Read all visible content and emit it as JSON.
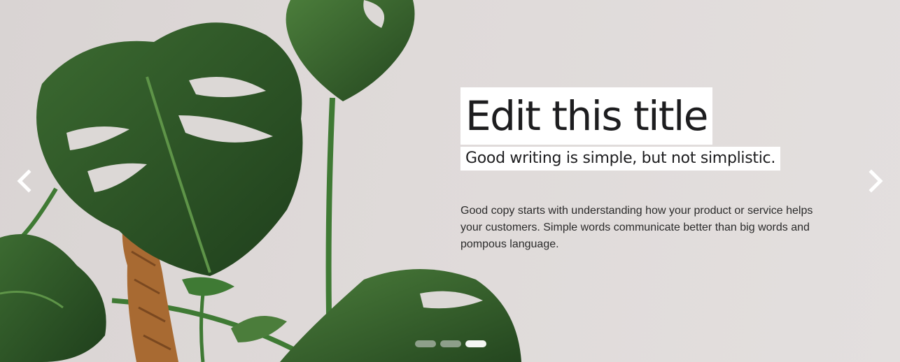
{
  "slide": {
    "title": "Edit this title",
    "subtitle": "Good writing is simple, but not simplistic.",
    "body": "Good copy starts with understanding how your product or service helps your customers. Simple words communicate better than big words and pompous language."
  },
  "controls": {
    "prev_icon": "chevron-left-icon",
    "next_icon": "chevron-right-icon",
    "slide_count": 3,
    "active_slide": 3
  },
  "background": {
    "subject": "monstera plant against light wall",
    "wall_color": "#ddd8d7",
    "leaf_color": "#2e5a28"
  }
}
